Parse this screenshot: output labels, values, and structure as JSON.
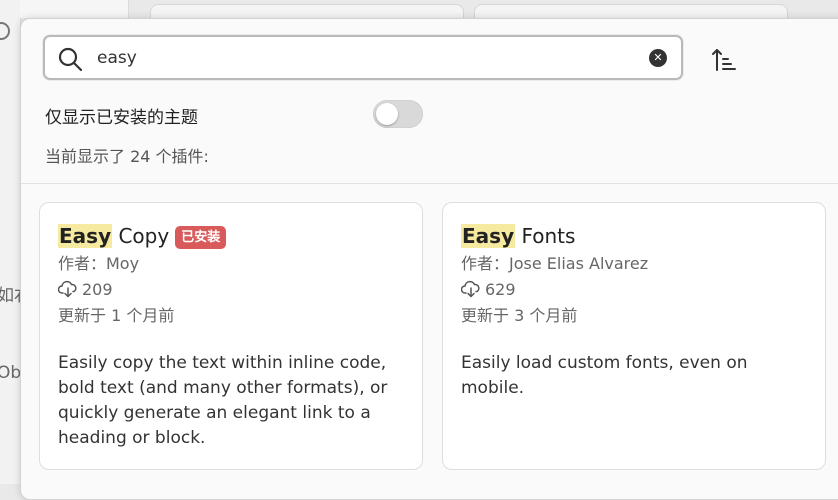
{
  "background": {
    "partial_text_1": "如右",
    "partial_text_2": "Ob"
  },
  "search": {
    "value": "easy",
    "placeholder": "",
    "search_icon": "search-icon",
    "clear_icon": "close-circle-icon"
  },
  "sort_icon": "sort-ascending-icon",
  "filter": {
    "label": "仅显示已安装的主题",
    "enabled": false
  },
  "results": {
    "count_text": "当前显示了 24 个插件:"
  },
  "colors": {
    "highlight": "#f6e9a0",
    "installed_badge": "#d85a5a"
  },
  "plugins": [
    {
      "title_match": "Easy",
      "title_rest": " Copy",
      "badge": "已安装",
      "author": "作者：Moy",
      "downloads": "209",
      "updated": "更新于 1 个月前",
      "description": "Easily copy the text within inline code, bold text (and many other formats), or quickly generate an elegant link to a heading or block."
    },
    {
      "title_match": "Easy",
      "title_rest": " Fonts",
      "badge": "",
      "author": "作者：Jose Elias Alvarez",
      "downloads": "629",
      "updated": "更新于 3 个月前",
      "description": "Easily load custom fonts, even on mobile."
    }
  ]
}
